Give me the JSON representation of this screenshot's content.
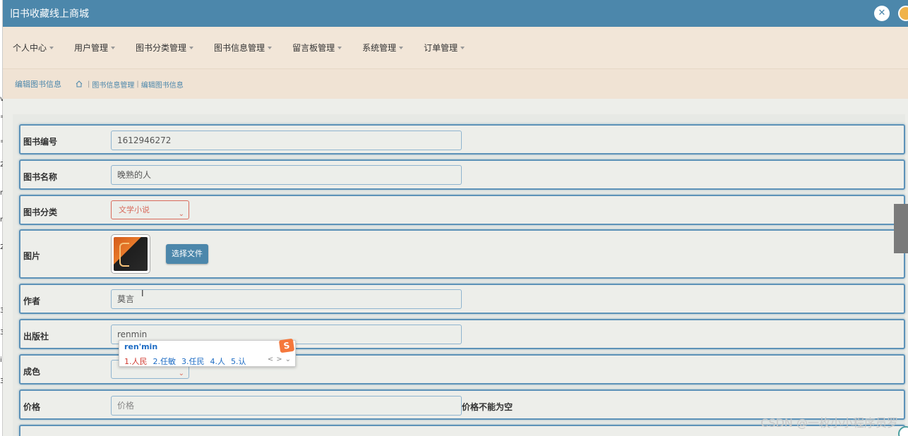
{
  "app": {
    "title": "旧书收藏线上商城"
  },
  "nav": {
    "items": [
      {
        "label": "个人中心"
      },
      {
        "label": "用户管理"
      },
      {
        "label": "图书分类管理"
      },
      {
        "label": "图书信息管理"
      },
      {
        "label": "留言板管理"
      },
      {
        "label": "系统管理"
      },
      {
        "label": "订单管理"
      }
    ]
  },
  "breadcrumb": {
    "title": "编辑图书信息",
    "path": [
      "图书信息管理",
      "编辑图书信息"
    ]
  },
  "form": {
    "book_id": {
      "label": "图书编号",
      "value": "1612946272"
    },
    "book_name": {
      "label": "图书名称",
      "value": "晚熟的人"
    },
    "category": {
      "label": "图书分类",
      "value": "文学小说"
    },
    "image": {
      "label": "图片",
      "button": "选择文件"
    },
    "author": {
      "label": "作者",
      "value": "莫言"
    },
    "publisher": {
      "label": "出版社",
      "value": "renmin"
    },
    "condition": {
      "label": "成色",
      "value": ""
    },
    "price": {
      "label": "价格",
      "placeholder": "价格",
      "error": "价格不能为空"
    }
  },
  "ime": {
    "composition": "ren'min",
    "logo": "S",
    "candidates": [
      "1.人民",
      "2.任敏",
      "3.任民",
      "4.人",
      "5.认"
    ],
    "prev": "<",
    "next": ">",
    "expand": "⌄"
  },
  "watermark": "CSDN @一枚小小程序员罗",
  "colors": {
    "primary": "#4c87ab",
    "nav_bg": "#f2e6d8",
    "select_accent": "#d86a5b"
  },
  "icons": {
    "close": "close-icon",
    "home": "home-icon",
    "dropdown": "chevron-down-icon"
  }
}
